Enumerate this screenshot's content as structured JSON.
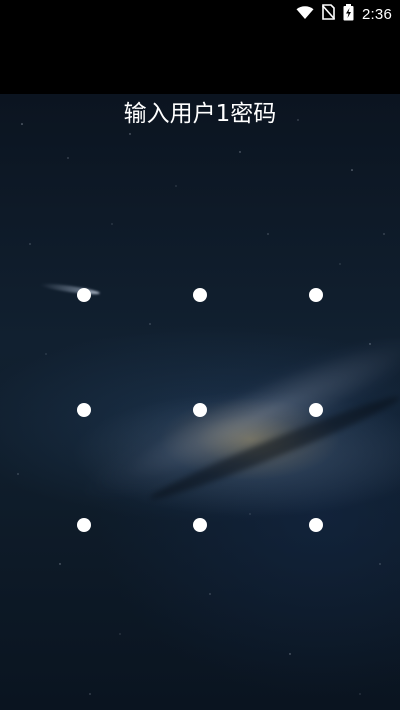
{
  "status_bar": {
    "time": "2:36",
    "icons": [
      "wifi-icon",
      "no-sim-icon",
      "battery-charging-icon"
    ]
  },
  "lock_screen": {
    "prompt": "输入用户1密码"
  },
  "pattern": {
    "rows": 3,
    "cols": 3,
    "dots": [
      {
        "row": 1,
        "col": 1
      },
      {
        "row": 1,
        "col": 2
      },
      {
        "row": 1,
        "col": 3
      },
      {
        "row": 2,
        "col": 1
      },
      {
        "row": 2,
        "col": 2
      },
      {
        "row": 2,
        "col": 3
      },
      {
        "row": 3,
        "col": 1
      },
      {
        "row": 3,
        "col": 2
      },
      {
        "row": 3,
        "col": 3
      }
    ]
  },
  "colors": {
    "dot": "#ffffff",
    "status_bar_bg": "#000000",
    "text": "#ffffff"
  }
}
